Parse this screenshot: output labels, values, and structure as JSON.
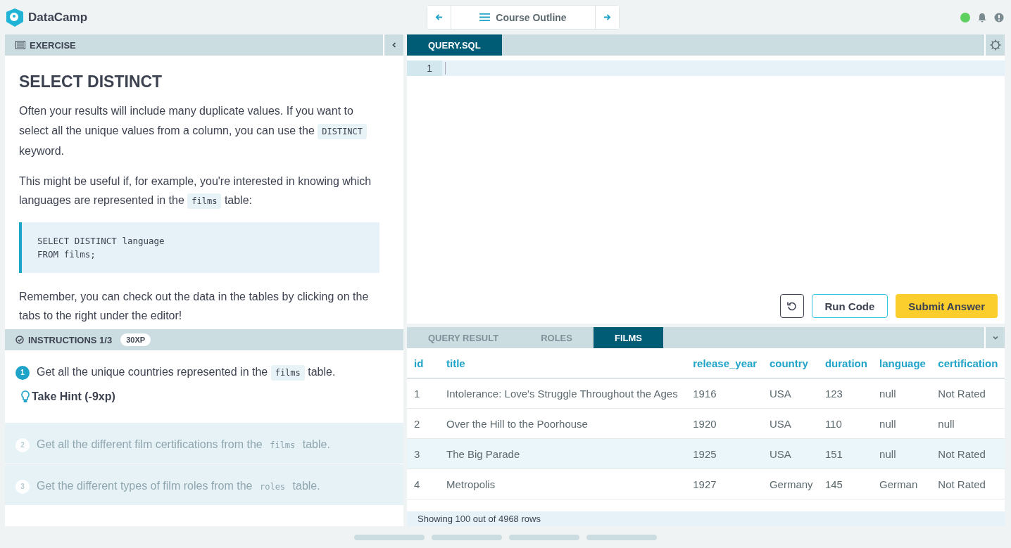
{
  "app": {
    "name": "DataCamp"
  },
  "course_nav": {
    "label": "Course Outline"
  },
  "status": {
    "connected": true
  },
  "exercise": {
    "header": "EXERCISE",
    "title": "SELECT DISTINCT",
    "paragraphs": [
      [
        {
          "kind": "text",
          "text": "Often your results will include many duplicate values. If you want to select all the unique values from a column, you can use the"
        },
        {
          "kind": "code",
          "text": "DISTINCT"
        },
        {
          "kind": "text",
          "text": "keyword."
        }
      ],
      [
        {
          "kind": "text",
          "text": "This might be useful if, for example, you're interested in knowing which languages are represented in the"
        },
        {
          "kind": "code",
          "text": "films"
        },
        {
          "kind": "text",
          "text": "table:"
        }
      ],
      [
        {
          "kind": "block",
          "lines": [
            "SELECT DISTINCT language",
            "FROM films;"
          ]
        }
      ],
      [
        {
          "kind": "text",
          "text": "Remember, you can check out the data in the tables by clicking on the tabs to the right under the editor!"
        }
      ]
    ]
  },
  "instructions": {
    "header": "INSTRUCTIONS 1/3",
    "xp": "30XP",
    "hint": "Take Hint (-9xp)",
    "steps": [
      {
        "number": "1",
        "active": true,
        "parts": [
          {
            "kind": "text",
            "text": "Get all the unique countries represented in the"
          },
          {
            "kind": "code",
            "text": "films"
          },
          {
            "kind": "text",
            "text": "table."
          }
        ]
      },
      {
        "number": "2",
        "active": false,
        "parts": [
          {
            "kind": "text",
            "text": "Get all the different film certifications from the"
          },
          {
            "kind": "code",
            "text": "films"
          },
          {
            "kind": "text",
            "text": "table."
          }
        ]
      },
      {
        "number": "3",
        "active": false,
        "parts": [
          {
            "kind": "text",
            "text": "Get the different types of film roles from the"
          },
          {
            "kind": "code",
            "text": "roles"
          },
          {
            "kind": "text",
            "text": "table."
          }
        ]
      }
    ]
  },
  "editor": {
    "tabs": [
      {
        "label": "QUERY.SQL",
        "selected": true
      }
    ],
    "line_numbers": [
      "1"
    ]
  },
  "buttons": [
    {
      "kind": "icon"
    },
    {
      "kind": "outline",
      "label": "Run Code"
    },
    {
      "kind": "primary",
      "label": "Submit Answer"
    }
  ],
  "results": {
    "tabs": [
      {
        "label": "QUERY RESULT",
        "selected": false
      },
      {
        "label": "ROLES",
        "selected": false
      },
      {
        "label": "FILMS",
        "selected": true
      }
    ],
    "columns": [
      "id",
      "title",
      "release_year",
      "country",
      "duration",
      "language",
      "certification"
    ],
    "rows": [
      {
        "hovered": false,
        "cells": [
          "1",
          "Intolerance: Love's Struggle Throughout the Ages",
          "1916",
          "USA",
          "123",
          "null",
          "Not Rated"
        ]
      },
      {
        "hovered": false,
        "cells": [
          "2",
          "Over the Hill to the Poorhouse",
          "1920",
          "USA",
          "110",
          "null",
          "null"
        ]
      },
      {
        "hovered": true,
        "cells": [
          "3",
          "The Big Parade",
          "1925",
          "USA",
          "151",
          "null",
          "Not Rated"
        ]
      },
      {
        "hovered": false,
        "cells": [
          "4",
          "Metropolis",
          "1927",
          "Germany",
          "145",
          "German",
          "Not Rated"
        ]
      }
    ],
    "footer": "Showing 100 out of 4968 rows"
  }
}
